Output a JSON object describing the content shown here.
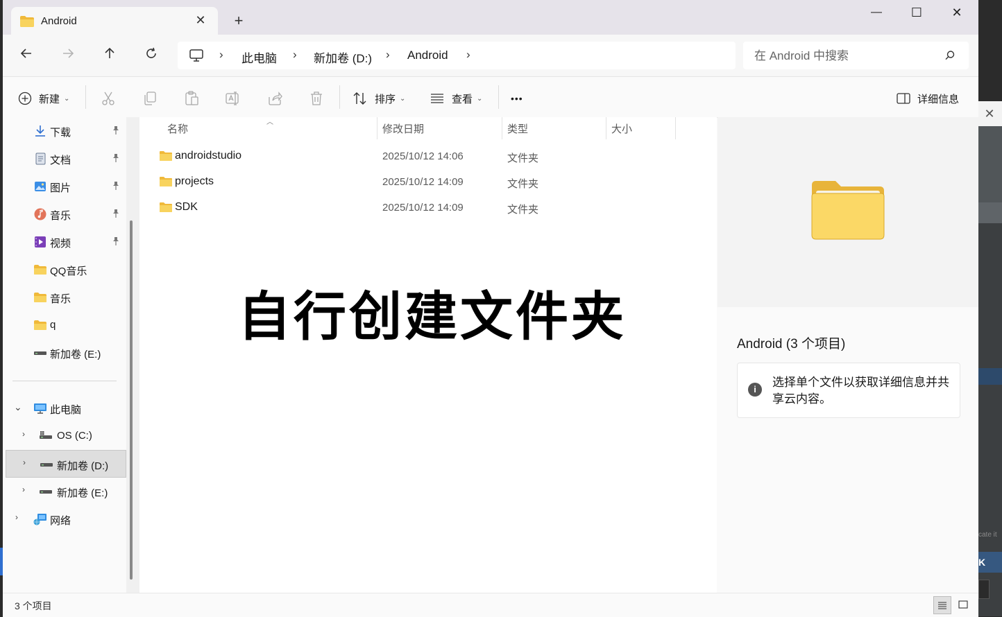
{
  "window": {
    "tab_title": "Android",
    "new_tab_glyph": "+",
    "close_tab_glyph": "✕",
    "minimize_glyph": "—",
    "maximize_glyph": "☐",
    "close_glyph": "✕"
  },
  "address": {
    "breadcrumb": [
      "此电脑",
      "新加卷 (D:)",
      "Android"
    ],
    "separator": "›",
    "search_placeholder": "在 Android 中搜索"
  },
  "toolbar": {
    "new_label": "新建",
    "sort_label": "排序",
    "view_label": "查看",
    "more_label": "•••",
    "details_label": "详细信息",
    "icons": [
      "cut-icon",
      "copy-icon",
      "paste-icon",
      "rename-icon",
      "share-icon",
      "delete-icon"
    ]
  },
  "sidebar": {
    "quick_access": [
      {
        "label": "下载",
        "icon": "download-icon",
        "pinned": true
      },
      {
        "label": "文档",
        "icon": "document-icon",
        "pinned": true
      },
      {
        "label": "图片",
        "icon": "pictures-icon",
        "pinned": true
      },
      {
        "label": "音乐",
        "icon": "music-icon",
        "pinned": true
      },
      {
        "label": "视频",
        "icon": "video-icon",
        "pinned": true
      },
      {
        "label": "QQ音乐",
        "icon": "folder-icon",
        "pinned": false
      },
      {
        "label": "音乐",
        "icon": "folder-icon",
        "pinned": false
      },
      {
        "label": "q",
        "icon": "folder-icon",
        "pinned": false
      },
      {
        "label": "新加卷 (E:)",
        "icon": "drive-icon",
        "pinned": false
      }
    ],
    "this_pc": "此电脑",
    "drives": [
      {
        "label": "OS (C:)",
        "icon": "os-drive-icon"
      },
      {
        "label": "新加卷 (D:)",
        "icon": "drive-icon",
        "selected": true
      },
      {
        "label": "新加卷 (E:)",
        "icon": "drive-icon"
      }
    ],
    "network": "网络"
  },
  "filelist": {
    "columns": [
      "名称",
      "修改日期",
      "类型",
      "大小"
    ],
    "rows": [
      {
        "name": "androidstudio",
        "date": "2025/10/12 14:06",
        "type": "文件夹"
      },
      {
        "name": "projects",
        "date": "2025/10/12 14:09",
        "type": "文件夹"
      },
      {
        "name": "SDK",
        "date": "2025/10/12 14:09",
        "type": "文件夹"
      }
    ],
    "overlay_text": "自行创建文件夹"
  },
  "details": {
    "title": "Android (3 个项目)",
    "info": "选择单个文件以获取详细信息并共享云内容。"
  },
  "status": {
    "count": "3 个项目"
  },
  "background_window": {
    "text": "cate it",
    "button": "K",
    "close_glyph": "✕"
  },
  "colors": {
    "folder": "#f5c84a",
    "accent": "#2f6fd0"
  }
}
